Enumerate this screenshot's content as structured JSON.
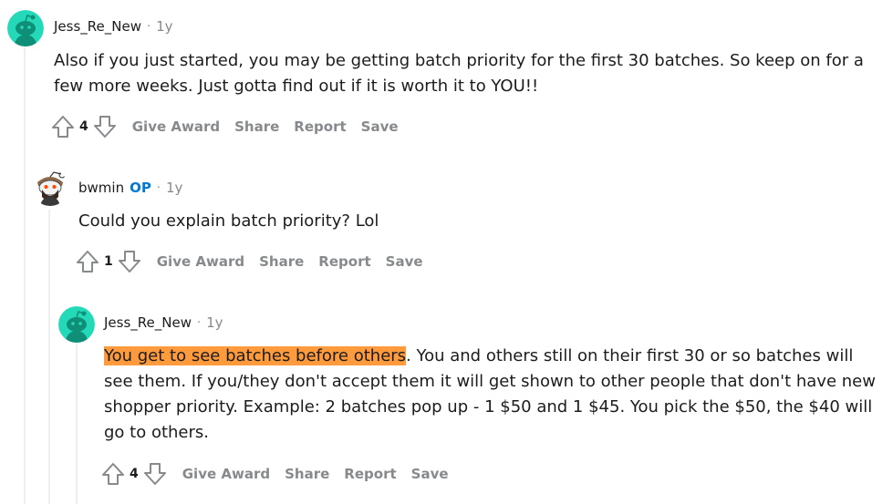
{
  "comments": [
    {
      "username": "Jess_Re_New",
      "op": "",
      "separator": "·",
      "time": "1y",
      "body_lines": [
        "Also if you just started, you may be getting batch priority for the first 30 batches. So keep on for a",
        "few more weeks. Just gotta find out if it is worth it to YOU!!"
      ],
      "score": "4",
      "actions": {
        "award": "Give Award",
        "share": "Share",
        "report": "Report",
        "save": "Save"
      },
      "avatar_color": "#24d9b8"
    },
    {
      "username": "bwmin",
      "op": "OP",
      "separator": "·",
      "time": "1y",
      "body_lines": [
        "Could you explain batch priority? Lol"
      ],
      "score": "1",
      "actions": {
        "award": "Give Award",
        "share": "Share",
        "report": "Report",
        "save": "Save"
      },
      "avatar_color": "#ffffff"
    },
    {
      "username": "Jess_Re_New",
      "op": "",
      "separator": "·",
      "time": "1y",
      "highlight": "You get to see batches before others",
      "body_first_rest": ". You and others still on their first 30 or so batches will",
      "body_lines": [
        "see them. If you/they don't accept them it will get shown to other people that don't have new",
        "shopper priority. Example: 2 batches pop up - 1 $50 and 1 $45. You pick the $50, the $40 will",
        "go to others."
      ],
      "score": "4",
      "actions": {
        "award": "Give Award",
        "share": "Share",
        "report": "Report",
        "save": "Save"
      },
      "avatar_color": "#24d9b8"
    }
  ],
  "colors": {
    "op": "#0079d3",
    "highlight": "#ff9a3d",
    "muted": "#878a8c",
    "thread_line": "#edeff1"
  }
}
